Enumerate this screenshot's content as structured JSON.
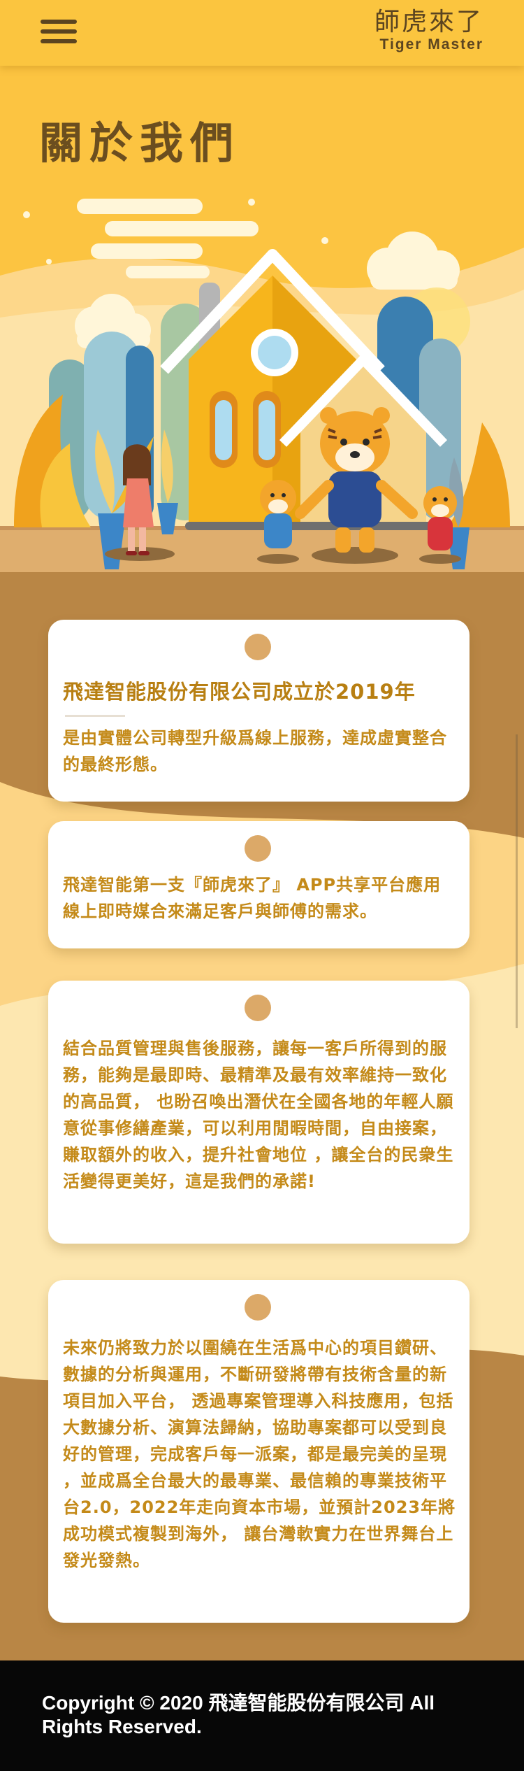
{
  "header": {
    "menu_label": "",
    "brand_zh": "師虎來了",
    "brand_en": "Tiger Master"
  },
  "hero": {
    "title": "關於我們",
    "icons": [
      "house-illustration",
      "tiger-mascot-icon",
      "woman-illustration",
      "plant-illustration"
    ]
  },
  "cards": [
    {
      "title": "飛達智能股份有限公司成立於2019年",
      "text": "是由實體公司轉型升級爲線上服務，達成虛實整合的最終形態。"
    },
    {
      "text": "飛達智能第一支『師虎來了』 APP共享平台應用線上即時媒合來滿足客戶與師傅的需求。"
    },
    {
      "text": "結合品質管理與售後服務，讓每一客戶所得到的服務，能夠是最即時、最精準及最有效率維持一致化的高品質， 也盼召喚出潛伏在全國各地的年輕人願意從事修繕產業，可以利用閒暇時間，自由接案，賺取額外的收入，提升社會地位 ，讓全台的民衆生活變得更美好，這是我們的承諾!"
    },
    {
      "text": "未來仍將致力於以圍繞在生活爲中心的項目鑽研、數據的分析與運用，不斷研發將帶有技術含量的新項目加入平台， 透過專案管理導入科技應用，包括大數據分析、演算法歸納，協助專案都可以受到良好的管理，完成客戶每一派案，都是最完美的呈現 ，並成爲全台最大的最專業、最信賴的專業技術平台2.0，2022年走向資本市場，並預計2023年將成功模式複製到海外， 讓台灣軟實力在世界舞台上發光發熱。"
    }
  ],
  "footer": {
    "copyright": "Copyright © 2020 飛達智能股份有限公司 All Rights Reserved."
  },
  "colors": {
    "header_bg": "#fbc53f",
    "brown_text": "#5b4420",
    "card_text": "#c48a19",
    "footer_bg": "#070707"
  }
}
